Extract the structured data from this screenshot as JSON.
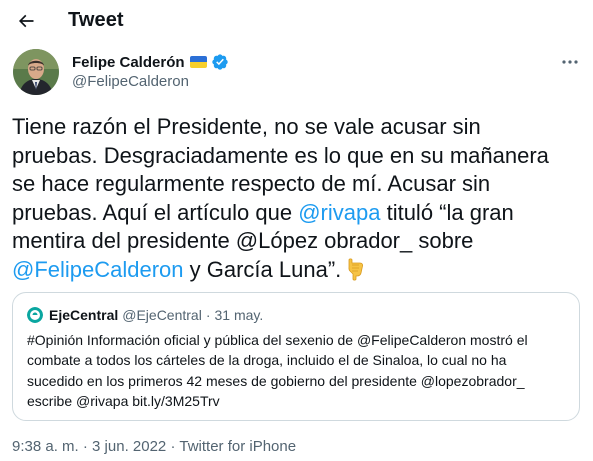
{
  "header": {
    "title": "Tweet"
  },
  "author": {
    "name": "Felipe Calderón",
    "handle": "@FelipeCalderon"
  },
  "tweet": {
    "lines": [
      [
        {
          "text": "Tiene razón el Presidente, no se vale acusar sin"
        }
      ],
      [
        {
          "text": "pruebas. Desgraciadamente es lo que en su mañanera"
        }
      ],
      [
        {
          "text": "se hace regularmente respecto de mí. Acusar sin"
        }
      ],
      [
        {
          "text": "pruebas. Aquí el artículo que "
        },
        {
          "text": "@rivapa",
          "link": true
        },
        {
          "text": " tituló “la gran"
        }
      ],
      [
        {
          "text": "mentira del presidente @López obrador_ sobre"
        }
      ],
      [
        {
          "text": "@FelipeCalderon",
          "link": true
        },
        {
          "text": " y García Luna”."
        }
      ]
    ]
  },
  "quote": {
    "name": "EjeCentral",
    "handle": "@EjeCentral",
    "separator": "·",
    "date": "31 may.",
    "lines": [
      "#Opinión Información oficial y pública del sexenio de @FelipeCalderon mostró el",
      "combate a todos los cárteles de la droga, incluido el de Sinaloa, lo cual no ha",
      "sucedido en los primeros 42 meses de gobierno del presidente @lopezobrador_",
      "escribe @rivapa bit.ly/3M25Trv"
    ]
  },
  "meta": {
    "time": "9:38 a. m.",
    "separator": "·",
    "date": "3 jun. 2022",
    "source": "Twitter for iPhone"
  },
  "icons": {
    "back": "arrow-left-icon",
    "verified": "verified-badge-icon",
    "flag": "ukraine-flag-icon",
    "more": "more-dots-icon",
    "emoji": "pointing-down-emoji"
  },
  "colors": {
    "link": "#1d9bf0",
    "secondary_text": "#536471",
    "border": "#cfd9de",
    "text": "#0f1419"
  }
}
